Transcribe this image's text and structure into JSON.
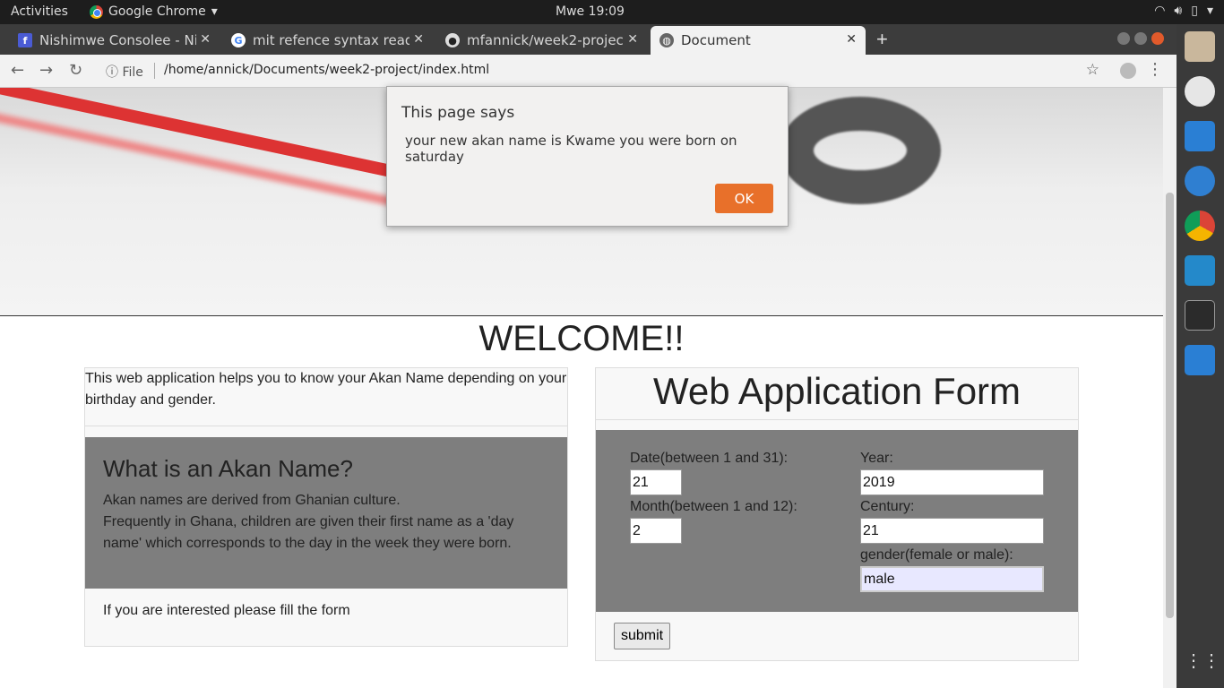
{
  "system": {
    "activities": "Activities",
    "app_name": "Google Chrome",
    "clock": "Mwe 19:09"
  },
  "tabs": [
    {
      "title": "Nishimwe Consolee - Nish",
      "icon": "facebook-icon"
    },
    {
      "title": "mit refence syntax read.m",
      "icon": "google-icon"
    },
    {
      "title": "mfannick/week2-project",
      "icon": "github-icon"
    },
    {
      "title": "Document",
      "icon": "globe-icon",
      "active": true
    }
  ],
  "omnibox": {
    "security_label": "File",
    "url": "/home/annick/Documents/week2-project/index.html"
  },
  "page": {
    "welcome": "WELCOME!!",
    "intro": "This web application helps you to know your Akan Name depending on your birthday and gender.",
    "akan_heading": "What is an Akan Name?",
    "akan_text_1": "Akan names are derived from Ghanian culture.",
    "akan_text_2": "Frequently in Ghana, children are given their first name as a 'day name' which corresponds to the day in the week they were born.",
    "interested": "If you are interested please fill the form",
    "form_title": "Web Application Form",
    "form": {
      "date_label": "Date(between 1 and 31):",
      "date_value": "21",
      "month_label": "Month(between 1 and 12):",
      "month_value": "2",
      "year_label": "Year:",
      "year_value": "2019",
      "century_label": "Century:",
      "century_value": "21",
      "gender_label": "gender(female or male):",
      "gender_value": "male",
      "submit_label": "submit"
    }
  },
  "dialog": {
    "title": "This page says",
    "message": "your new akan name is Kwame you were born on saturday",
    "ok_label": "OK"
  }
}
